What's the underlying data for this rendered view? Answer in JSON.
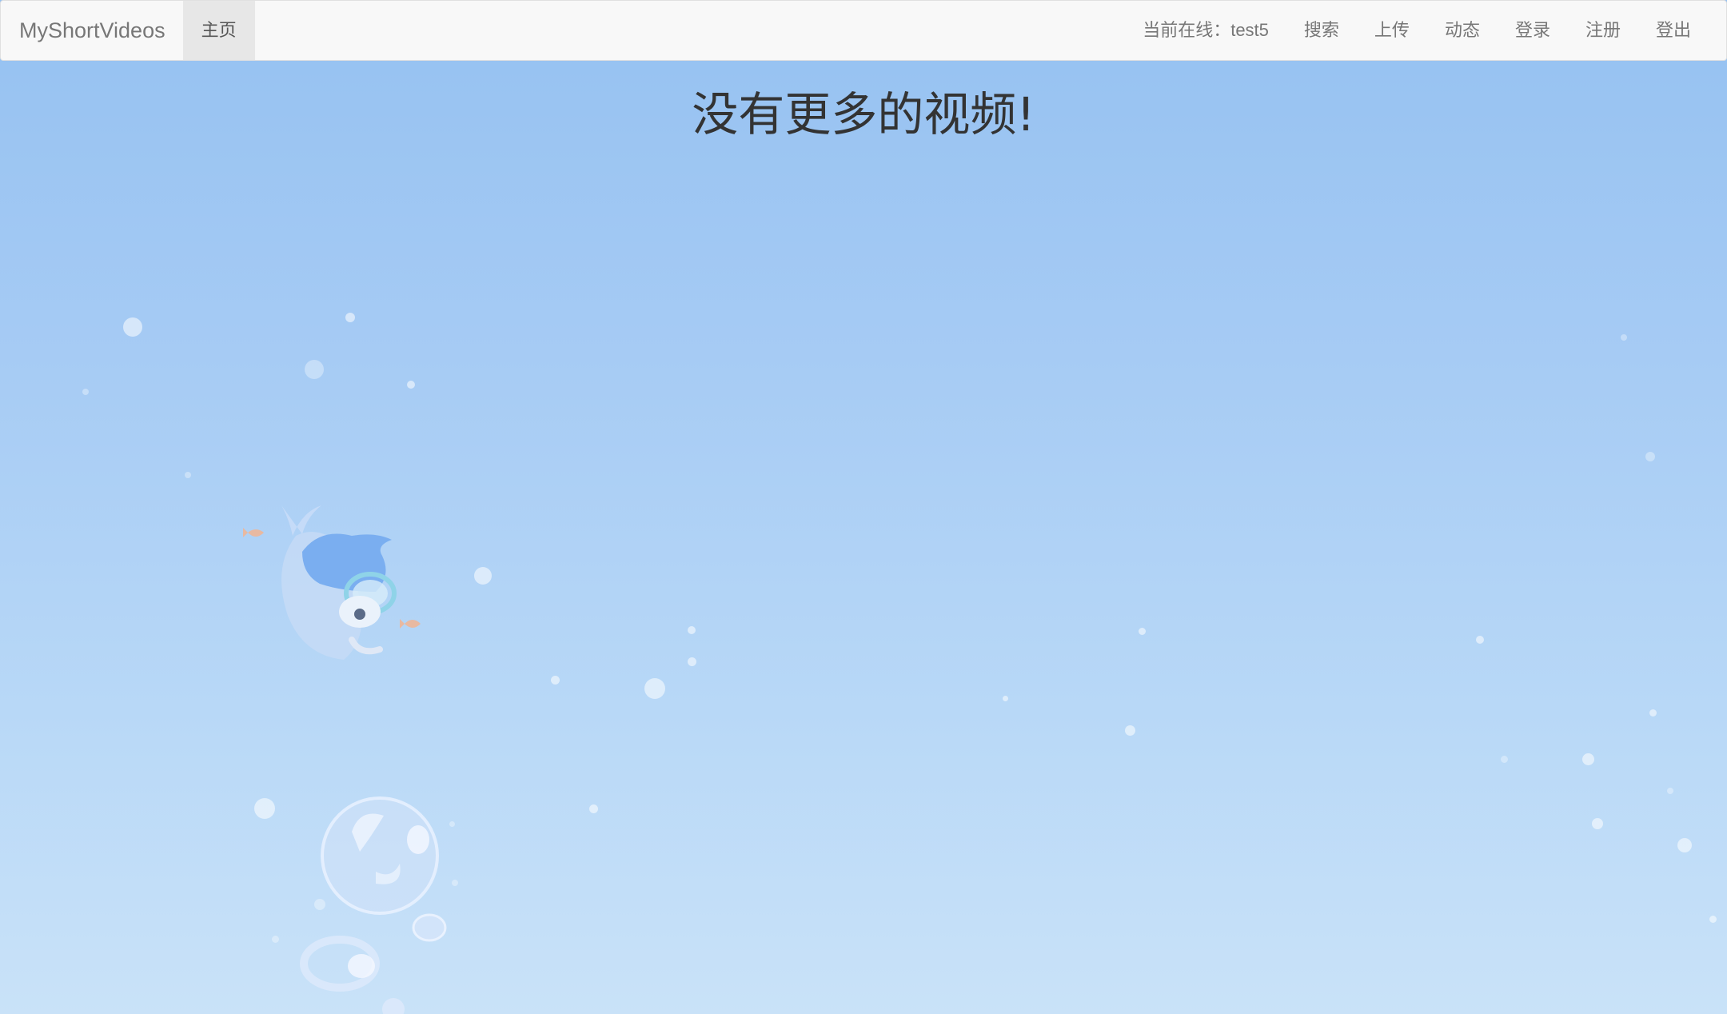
{
  "navbar": {
    "brand": "MyShortVideos",
    "home_label": "主页",
    "status_text": "当前在线：test5",
    "items": [
      {
        "label": "搜索"
      },
      {
        "label": "上传"
      },
      {
        "label": "动态"
      },
      {
        "label": "登录"
      },
      {
        "label": "注册"
      },
      {
        "label": "登出"
      }
    ]
  },
  "main": {
    "message": "没有更多的视频!"
  },
  "background": {
    "top_color": "#95c1f1",
    "bottom_color": "#c9e2f8",
    "decoration": [
      "whale-mascot-icon",
      "bubbles"
    ]
  }
}
